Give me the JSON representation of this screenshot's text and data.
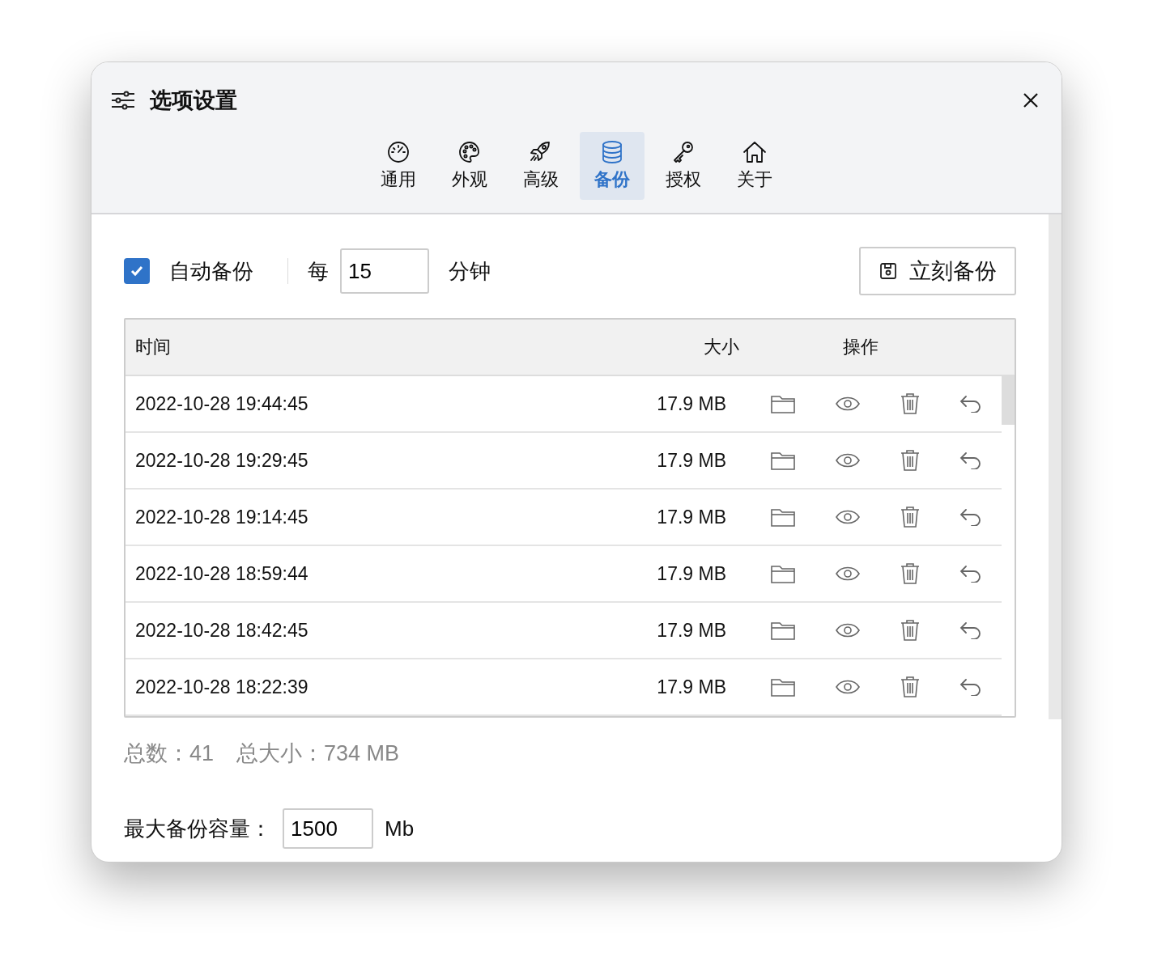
{
  "window": {
    "title": "选项设置"
  },
  "tabs": [
    {
      "label": "通用",
      "selected": false
    },
    {
      "label": "外观",
      "selected": false
    },
    {
      "label": "高级",
      "selected": false
    },
    {
      "label": "备份",
      "selected": true
    },
    {
      "label": "授权",
      "selected": false
    },
    {
      "label": "关于",
      "selected": false
    }
  ],
  "auto_backup": {
    "label": "自动备份",
    "checked": true,
    "every_label": "每",
    "interval": "15",
    "unit": "分钟"
  },
  "backup_now_button": "立刻备份",
  "table": {
    "columns": [
      "时间",
      "大小",
      "操作"
    ],
    "rows": [
      {
        "time": "2022-10-28 19:44:45",
        "size": "17.9 MB"
      },
      {
        "time": "2022-10-28 19:29:45",
        "size": "17.9 MB"
      },
      {
        "time": "2022-10-28 19:14:45",
        "size": "17.9 MB"
      },
      {
        "time": "2022-10-28 18:59:44",
        "size": "17.9 MB"
      },
      {
        "time": "2022-10-28 18:42:45",
        "size": "17.9 MB"
      },
      {
        "time": "2022-10-28 18:22:39",
        "size": "17.9 MB"
      }
    ]
  },
  "summary": {
    "count_label": "总数：",
    "count": "41",
    "size_label": "总大小：",
    "size": "734 MB"
  },
  "max_capacity": {
    "label": "最大备份容量：",
    "value": "1500",
    "unit": "Mb"
  }
}
